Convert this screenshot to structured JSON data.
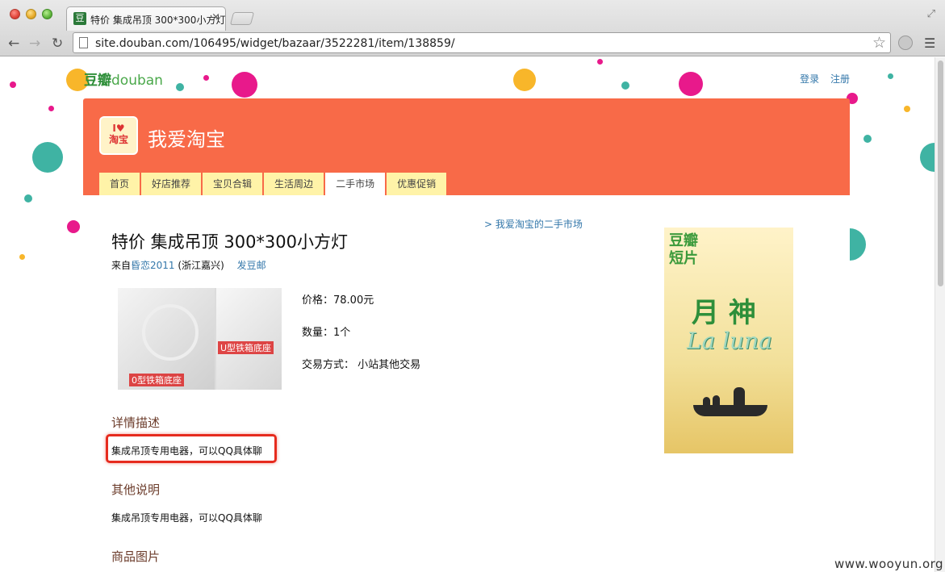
{
  "browser": {
    "tab_title": "特价 集成吊顶 300*300小方灯",
    "tab_close": "×",
    "tab_favicon": "豆",
    "url": "site.douban.com/106495/widget/bazaar/3522281/item/138859/",
    "icons": [
      "back-arrow-icon",
      "forward-arrow-icon",
      "reload-icon",
      "page-icon",
      "star-icon",
      "extension-icon",
      "menu-icon",
      "fullscreen-icon"
    ]
  },
  "site": {
    "logo_cn": "豆瓣",
    "logo_en": "douban",
    "login": "登录",
    "register": "注册"
  },
  "group": {
    "icon_text_1": "I♥",
    "icon_text_2": "淘宝",
    "title": "我爱淘宝",
    "nav": [
      {
        "label": "首页",
        "active": false
      },
      {
        "label": "好店推荐",
        "active": false
      },
      {
        "label": "宝贝合辑",
        "active": false
      },
      {
        "label": "生活周边",
        "active": false
      },
      {
        "label": "二手市场",
        "active": true
      },
      {
        "label": "优惠促销",
        "active": false
      }
    ],
    "accent_color": "#f86a48",
    "tab_color": "#fff3a8"
  },
  "item": {
    "market_link": "> 我爱淘宝的二手市场",
    "title": "特价 集成吊顶 300*300小方灯",
    "from_prefix": "来自",
    "owner": "昏恋2011",
    "location": "(浙江嘉兴)",
    "send_mail": "发豆邮",
    "photo_label_1": "0型铁箱底座",
    "photo_label_2": "U型铁箱底座",
    "price": "价格：78.00元",
    "quantity": "数量：1个",
    "trade_method": "交易方式：  小站其他交易"
  },
  "sections": {
    "details_title": "详情描述",
    "details_text": "集成吊顶专用电器，可以QQ具体聊",
    "other_title": "其他说明",
    "other_text": "集成吊顶专用电器，可以QQ具体聊",
    "images_title": "商品图片"
  },
  "ad": {
    "brand_line1": "豆瓣",
    "brand_line2": "短片",
    "title": "月 神",
    "subtitle": "La luna"
  },
  "watermark": "www.wooyun.org"
}
